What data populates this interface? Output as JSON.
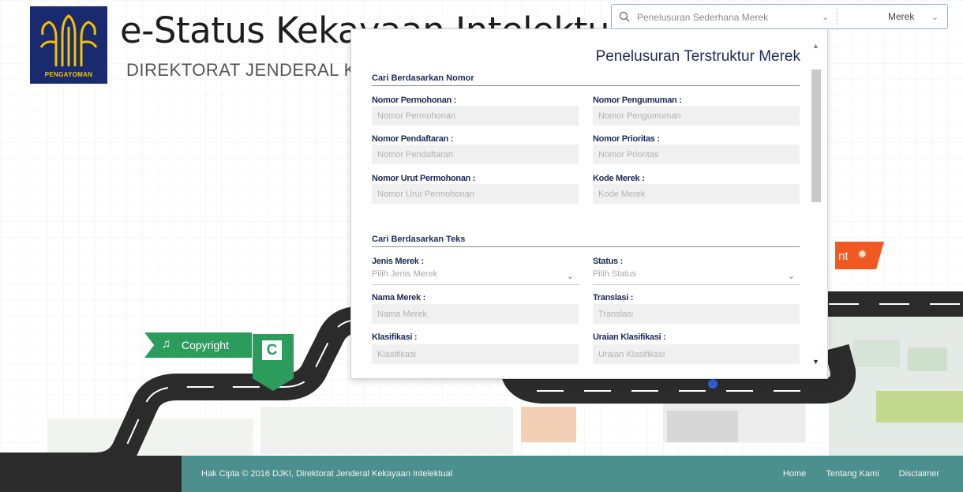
{
  "header": {
    "logo_text": "PENGAYOMAN",
    "title": "e-Status Kekayaan Intelektual",
    "subtitle": "DIREKTORAT JENDERAL KEKAYAAN INTELEKTUAL"
  },
  "search": {
    "placeholder": "Penelusuran Sederhana Merek",
    "category": "Merek"
  },
  "modal": {
    "title": "Penelusuran Terstruktur Merek",
    "section_nomor": "Cari Berdasarkan Nomor",
    "section_teks": "Cari Berdasarkan Teks",
    "fields": {
      "nomor_permohonan": {
        "label": "Nomor Permohonan :",
        "placeholder": "Nomor Permohonan"
      },
      "nomor_pengumuman": {
        "label": "Nomor Pengumuman :",
        "placeholder": "Nomor Pengumuman"
      },
      "nomor_pendaftaran": {
        "label": "Nomor Pendaftaran :",
        "placeholder": "Nomor Pendaftaran"
      },
      "nomor_prioritas": {
        "label": "Nomor Prioritas :",
        "placeholder": "Nomor Prioritas"
      },
      "nomor_urut": {
        "label": "Nomor Urut Permohonan :",
        "placeholder": "Nomor Urut Permohonan"
      },
      "kode_merek": {
        "label": "Kode Merek :",
        "placeholder": "Kode Merek"
      },
      "jenis_merek": {
        "label": "Jenis Merek :",
        "placeholder": "Pilih Jenis Merek"
      },
      "status": {
        "label": "Status :",
        "placeholder": "Pilih Status"
      },
      "nama_merek": {
        "label": "Nama Merek :",
        "placeholder": "Nama Merek"
      },
      "translasi": {
        "label": "Translasi :",
        "placeholder": "Translasi"
      },
      "klasifikasi": {
        "label": "Klasifikasi :",
        "placeholder": "Klasifikasi"
      },
      "uraian_klasifikasi": {
        "label": "Uraian Klasifikasi :",
        "placeholder": "Uraian Klasifikasi"
      }
    }
  },
  "scene": {
    "copyright_label": "Copyright",
    "copyright_letter": "C",
    "patent_label_partial": "nt"
  },
  "footer": {
    "copyright": "Hak Cipta © 2016 DJKI, Direktorat Jenderal Kekayaan Intelektual",
    "links": [
      "Home",
      "Tentang Kami",
      "Disclaimer"
    ]
  },
  "colors": {
    "brand_navy": "#1a2a6e",
    "logo_gold": "#f2c200",
    "copyright_green": "#2c9c5c",
    "patent_orange": "#f05a22",
    "footer_teal": "#4c908e",
    "road": "#2b2b2b"
  }
}
